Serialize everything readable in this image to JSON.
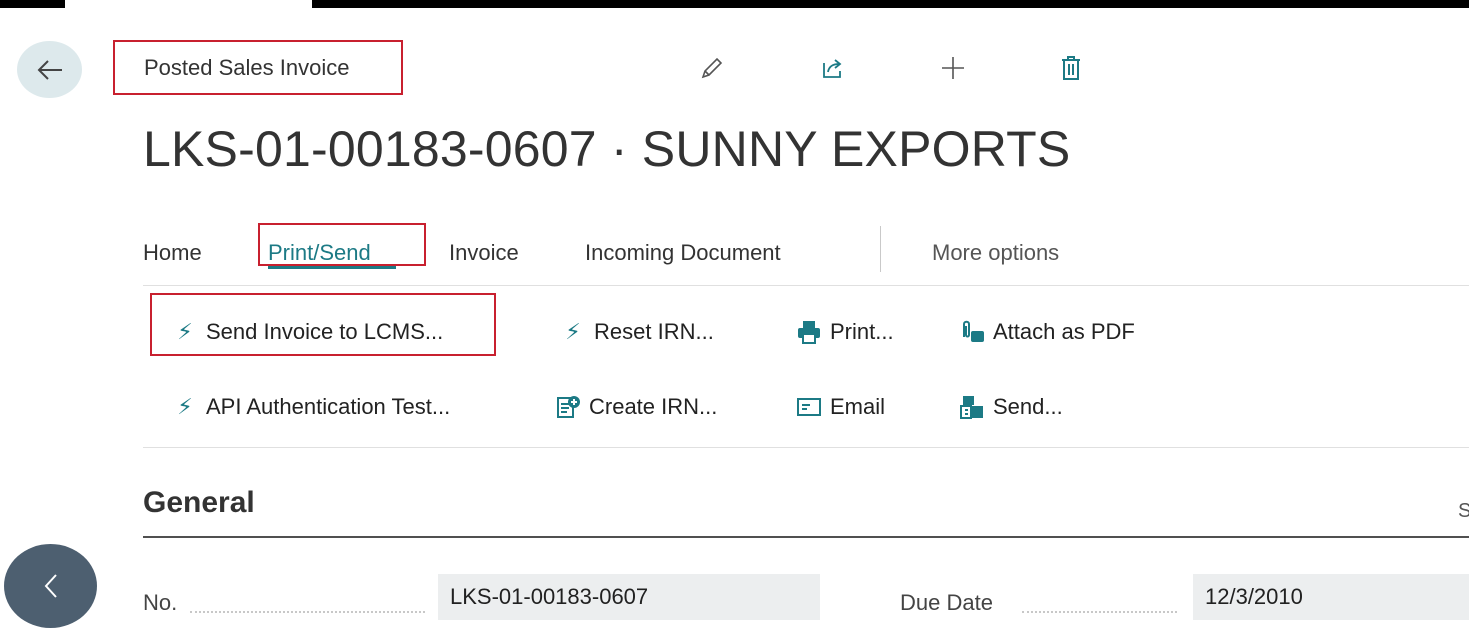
{
  "page": {
    "breadcrumb": "Posted Sales Invoice",
    "title": "LKS-01-00183-0607 · SUNNY EXPORTS"
  },
  "header_icons": {
    "back": "back-arrow-icon",
    "edit": "pencil-icon",
    "share": "share-icon",
    "new": "plus-icon",
    "delete": "trash-icon"
  },
  "tabs": [
    {
      "label": "Home"
    },
    {
      "label": "Print/Send",
      "active": true
    },
    {
      "label": "Invoice"
    },
    {
      "label": "Incoming Document"
    },
    {
      "label": "More options"
    }
  ],
  "actions": {
    "send_invoice_lcms": "Send Invoice to LCMS...",
    "reset_irn": "Reset IRN...",
    "print": "Print...",
    "attach_pdf": "Attach as PDF",
    "api_auth_test": "API Authentication Test...",
    "create_irn": "Create IRN...",
    "email": "Email",
    "send": "Send..."
  },
  "general": {
    "title": "General",
    "show_more_partial": "S",
    "fields": {
      "no_label": "No.",
      "no_value": "LKS-01-00183-0607",
      "due_date_label": "Due Date",
      "due_date_value": "12/3/2010"
    }
  },
  "colors": {
    "accent": "#1c7a85",
    "highlight_box": "#c8202f",
    "nav_circle": "#4d5f70",
    "back_circle": "#dde9ec"
  }
}
